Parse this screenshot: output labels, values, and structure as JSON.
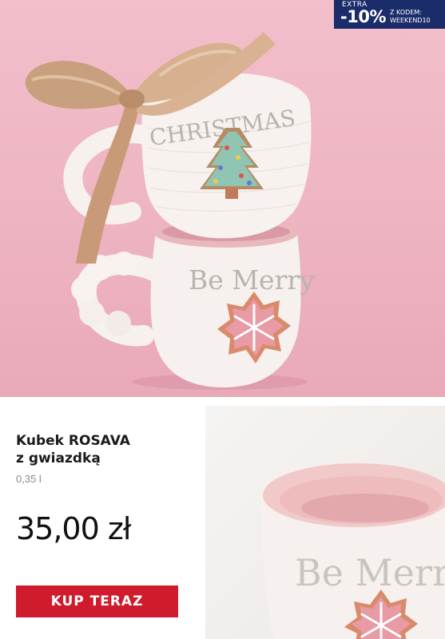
{
  "promo": {
    "extra": "EXTRA",
    "discount": "-10%",
    "code_line1": "Z KODEM:",
    "code_line2": "WEEKEND10"
  },
  "hero": {
    "mug_top_text": "CHRISTMAS",
    "mug_bottom_text": "Be Merry"
  },
  "product": {
    "title_line1": "Kubek ROSAVA",
    "title_line2": "z gwiazdką",
    "volume": "0,35 l",
    "price": "35,00 zł",
    "buy_label": "KUP TERAZ"
  },
  "detail": {
    "mug_text": "Be Merry"
  },
  "colors": {
    "background_pink": "#eeb4c2",
    "promo_navy": "#1b2c6b",
    "buy_red": "#cf1b2c"
  }
}
